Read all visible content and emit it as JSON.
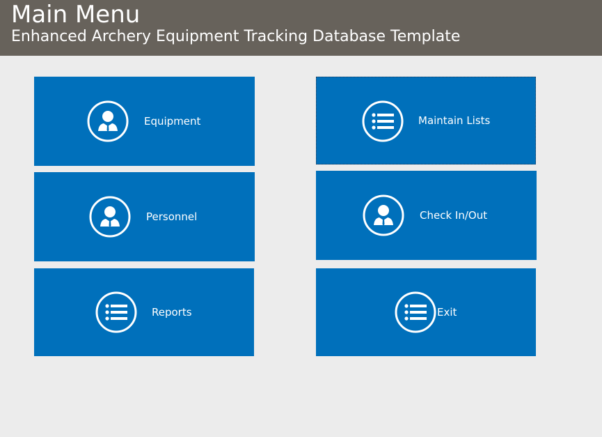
{
  "header": {
    "title": "Main Menu",
    "subtitle": "Enhanced Archery Equipment Tracking Database Template"
  },
  "tiles": [
    {
      "label": "Equipment",
      "icon": "person-icon"
    },
    {
      "label": "Personnel",
      "icon": "person-icon"
    },
    {
      "label": "Reports",
      "icon": "list-icon"
    },
    {
      "label": "Maintain Lists",
      "icon": "list-icon"
    },
    {
      "label": "Check In/Out",
      "icon": "person-icon"
    },
    {
      "label": "Exit",
      "icon": "list-icon"
    }
  ],
  "colors": {
    "header_bg": "#67625b",
    "tile_bg": "#0070bb",
    "page_bg": "#ececec"
  }
}
